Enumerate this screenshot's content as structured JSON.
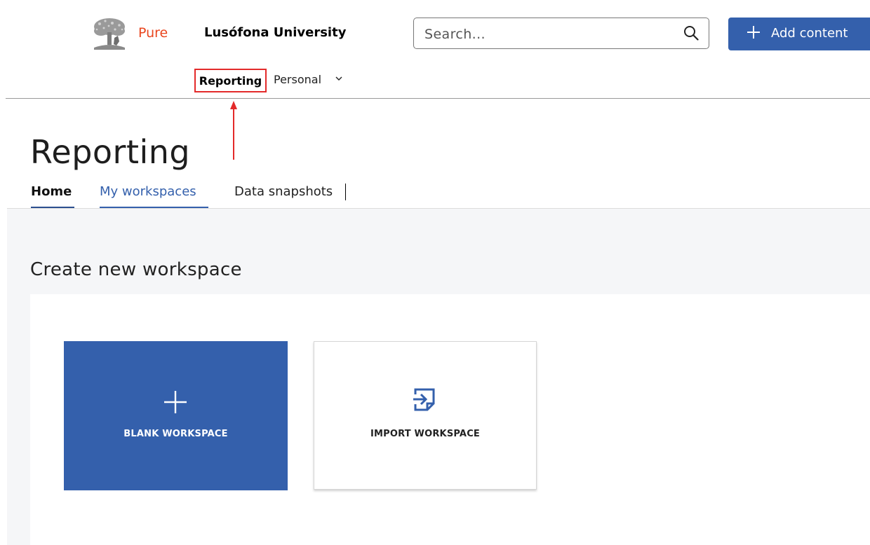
{
  "header": {
    "brand": "Pure",
    "organization": "Lusófona University",
    "search": {
      "placeholder": "Search..."
    },
    "add_button": {
      "label": "Add content"
    },
    "logo_icon": "elsevier-tree-logo"
  },
  "nav": {
    "items": [
      {
        "label": "Reporting",
        "highlighted": true
      },
      {
        "label": "Personal",
        "has_dropdown": true
      }
    ]
  },
  "page": {
    "title": "Reporting",
    "tabs": [
      {
        "label": "Home",
        "active": true
      },
      {
        "label": "My workspaces",
        "hover": true
      },
      {
        "label": "Data snapshots"
      }
    ]
  },
  "create": {
    "title": "Create new workspace",
    "tiles": [
      {
        "label": "BLANK WORKSPACE",
        "icon": "plus-icon"
      },
      {
        "label": "IMPORT WORKSPACE",
        "icon": "import-icon"
      }
    ]
  },
  "colors": {
    "accent": "#3460ac",
    "brand": "#e9461f",
    "annotation": "#e32a2a",
    "content_bg": "#f5f6f8"
  }
}
